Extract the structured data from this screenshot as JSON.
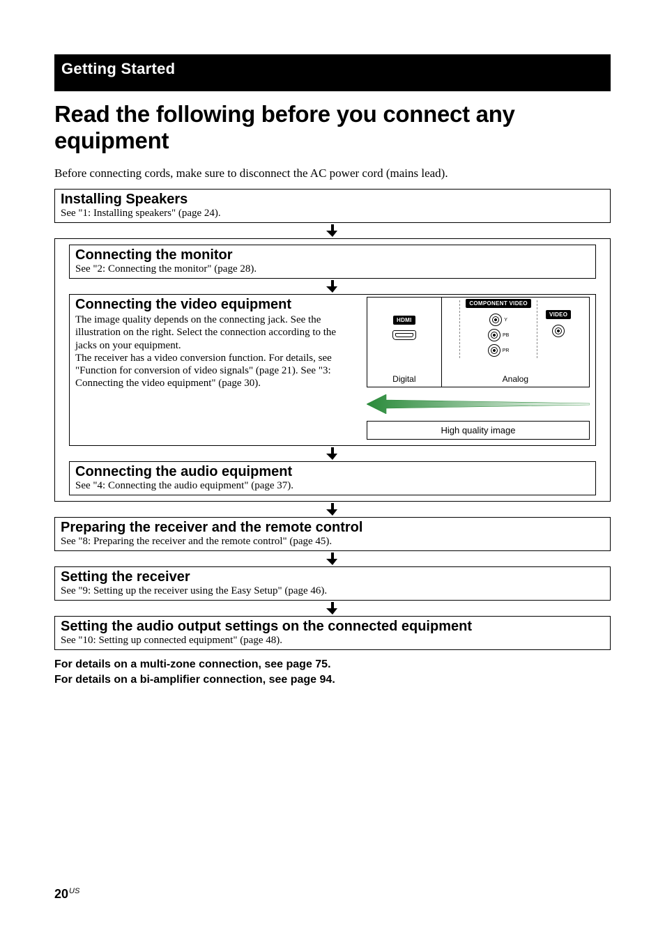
{
  "section_tab": "Getting Started",
  "main_title": "Read the following before you connect any equipment",
  "intro": "Before connecting cords, make sure to disconnect the AC power cord (mains lead).",
  "step1": {
    "heading": "Installing Speakers",
    "ref": "See \"1: Installing speakers\" (page 24)."
  },
  "step2": {
    "heading": "Connecting the monitor",
    "ref": "See \"2: Connecting the monitor\" (page 28)."
  },
  "step3": {
    "heading": "Connecting the video equipment",
    "desc": "The image quality depends on the connecting jack. See the illustration on the right. Select the connection according to the jacks on your equipment.\nThe receiver has a video conversion function. For details, see \"Function for conversion of video signals\" (page 21). See \"3: Connecting the video equipment\" (page 30).",
    "panel": {
      "hdmi_badge": "HDMI",
      "component_badge": "COMPONENT VIDEO",
      "video_badge": "VIDEO",
      "y": "Y",
      "pb": "PB",
      "pr": "PR",
      "digital": "Digital",
      "analog": "Analog",
      "hq": "High quality image"
    }
  },
  "step4": {
    "heading": "Connecting the audio equipment",
    "ref": "See \"4: Connecting the audio equipment\" (page 37)."
  },
  "step5": {
    "heading": "Preparing the receiver and the remote control",
    "ref": "See \"8: Preparing the receiver and the remote control\" (page 45)."
  },
  "step6": {
    "heading": "Setting the receiver",
    "ref": "See \"9: Setting up the receiver using the Easy Setup\" (page 46)."
  },
  "step7": {
    "heading": "Setting the audio output settings on the connected equipment",
    "ref": "See \"10: Setting up connected equipment\" (page 48)."
  },
  "footer": {
    "line1": "For details on a multi-zone connection, see page 75.",
    "line2": "For details on a bi-amplifier connection, see page 94."
  },
  "page": {
    "num": "20",
    "region": "US"
  }
}
